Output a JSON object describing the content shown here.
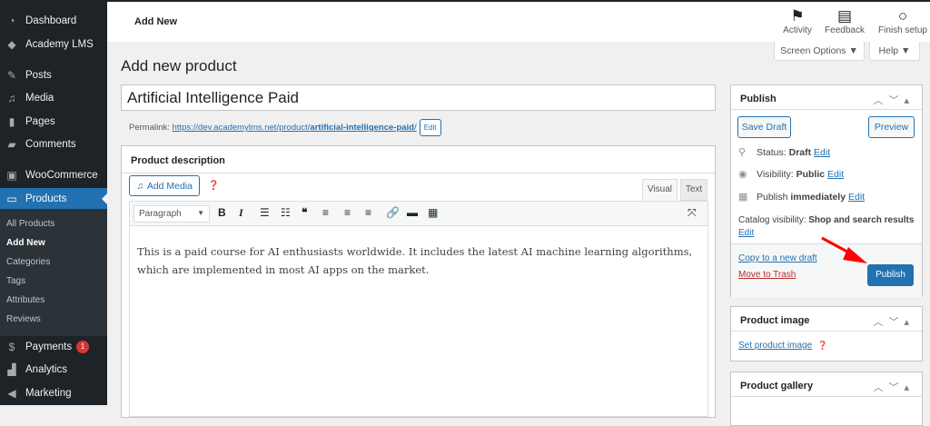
{
  "sidebar": {
    "items": [
      {
        "label": "Dashboard",
        "icon": "dashboard-icon"
      },
      {
        "label": "Academy LMS",
        "icon": "academy-icon"
      },
      {
        "label": "Posts",
        "icon": "pin-icon"
      },
      {
        "label": "Media",
        "icon": "media-icon"
      },
      {
        "label": "Pages",
        "icon": "pages-icon"
      },
      {
        "label": "Comments",
        "icon": "comment-icon"
      },
      {
        "label": "WooCommerce",
        "icon": "woo-icon"
      },
      {
        "label": "Products",
        "icon": "archive-icon"
      },
      {
        "label": "Payments",
        "icon": "payments-icon",
        "badge": "1"
      },
      {
        "label": "Analytics",
        "icon": "chart-icon"
      },
      {
        "label": "Marketing",
        "icon": "megaphone-icon"
      }
    ],
    "submenu": [
      "All Products",
      "Add New",
      "Categories",
      "Tags",
      "Attributes",
      "Reviews"
    ]
  },
  "topbar": {
    "title": "Add New",
    "activity": "Activity",
    "feedback": "Feedback",
    "finish": "Finish setup"
  },
  "screen_options": "Screen Options ▼",
  "help": "Help ▼",
  "page_title": "Add new product",
  "post_title": "Artificial Intelligence Paid",
  "permalink": {
    "label": "Permalink:",
    "base": "https://dev.academylms.net/product/",
    "slug": "artificial-intelligence-paid",
    "trail": "/",
    "edit": "Edit"
  },
  "description": {
    "title": "Product description",
    "add_media": "Add Media",
    "tab_visual": "Visual",
    "tab_text": "Text",
    "format": "Paragraph",
    "content": "This is a paid course for AI enthusiasts worldwide. It includes the latest AI machine learning algorithms, which are implemented in most AI apps on the market."
  },
  "publish": {
    "title": "Publish",
    "save_draft": "Save Draft",
    "preview": "Preview",
    "status_label": "Status:",
    "status": "Draft",
    "visibility_label": "Visibility:",
    "visibility": "Public",
    "publish_label": "Publish",
    "publish_when": "immediately",
    "catalog_label": "Catalog visibility:",
    "catalog": "Shop and search results",
    "edit": "Edit",
    "copy": "Copy to a new draft",
    "trash": "Move to Trash",
    "publish_btn": "Publish"
  },
  "product_image": {
    "title": "Product image",
    "link": "Set product image"
  },
  "product_gallery": {
    "title": "Product gallery"
  },
  "colors": {
    "accent": "#2271b1",
    "sidebar": "#1d2327",
    "arrow": "#ff0000"
  }
}
